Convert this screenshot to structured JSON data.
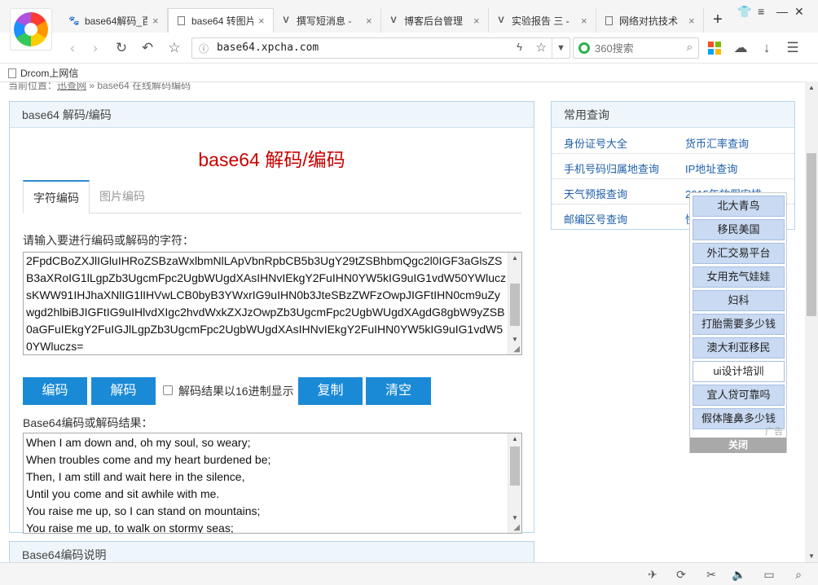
{
  "browser": {
    "tabs": [
      {
        "label": "base64解码_百",
        "icon": "paw-icon"
      },
      {
        "label": "base64 转图片",
        "icon": "document-icon",
        "active": true
      },
      {
        "label": "撰写短消息 -",
        "icon": "v-icon"
      },
      {
        "label": "博客后台管理",
        "icon": "v-icon"
      },
      {
        "label": "实验报告 三 -",
        "icon": "v-icon"
      },
      {
        "label": "网络对抗技术",
        "icon": "document-icon"
      }
    ],
    "close_glyph": "×",
    "new_tab": "+",
    "url": "base64.xpcha.com",
    "search_placeholder": "360搜索",
    "bookmark": "Drcom上网信"
  },
  "page": {
    "breadcrumb_prefix": "当前位置：",
    "breadcrumb_home": "迅查网",
    "breadcrumb_sep": " » ",
    "breadcrumb_current": "base64 在线解码编码",
    "main_panel_title": "base64 解码/编码",
    "big_title": "base64 解码/编码",
    "tabs": [
      "字符编码",
      "图片编码"
    ],
    "input_prompt": "请输入要进行编码或解码的字符：",
    "input_text": "2FpdCBoZXJlIGluIHRoZSBzaWxlbmNlLApVbnRpbCB5b3UgY29tZSBhbmQgc2l0IGF3aGlsZSB3aXRoIG1lLgpZb3UgcmFpc2UgbWUgdXAsIHNvIEkgY2FuIHN0YW5kIG9uIG1vdW50YWluczsKWW91IHJhaXNlIG1lIHVwLCB0byB3YWxrIG9uIHN0b3JteSBzZWFzOwpJIGFtIHN0cm9uZywgd2hlbiBJIGFtIG9uIHlvdXIgc2hvdWxkZXJzOwpZb3UgcmFpc2UgbWUgdXAgdG8gbW9yZSB0aGFuIEkgY2FuIGJlLgpZb3UgcmFpc2UgbWUgdXAsIHNvIEkgY2FuIHN0YW5kIG9uIG1vdW50YWluczs=",
    "buttons": {
      "encode": "编码",
      "decode": "解码",
      "copy": "复制",
      "clear": "清空"
    },
    "hex_checkbox_label": "解码结果以16进制显示",
    "result_label": "Base64编码或解码结果：",
    "result_lines": [
      "When I am down and, oh my soul, so weary;",
      "When troubles come and my heart burdened be;",
      "Then, I am still and wait here in the silence,",
      "Until you come and sit awhile with me.",
      "You raise me up, so I can stand on mountains;",
      "You raise me up, to walk on stormy seas;"
    ],
    "desc_panel_title": "Base64编码说明"
  },
  "sidebar": {
    "title": "常用查询",
    "rows": [
      [
        "身份证号大全",
        "货币汇率查询"
      ],
      [
        "手机号码归属地查询",
        "IP地址查询"
      ],
      [
        "天气预报查询",
        "2015年放假安排"
      ],
      [
        "邮编区号查询",
        "快"
      ]
    ]
  },
  "ad": {
    "items": [
      "北大青鸟",
      "移民美国",
      "外汇交易平台",
      "女用充气娃娃",
      "妇科",
      "打胎需要多少钱",
      "澳大利亚移民",
      "ui设计培训",
      "宜人贷可靠吗",
      "假体隆鼻多少钱"
    ],
    "tag": "广告",
    "close": "关闭"
  },
  "colors": {
    "accent": "#1a8ad6",
    "title_red": "#cc0000",
    "link": "#1e5fa8",
    "panel_border": "#b8d4e8"
  }
}
